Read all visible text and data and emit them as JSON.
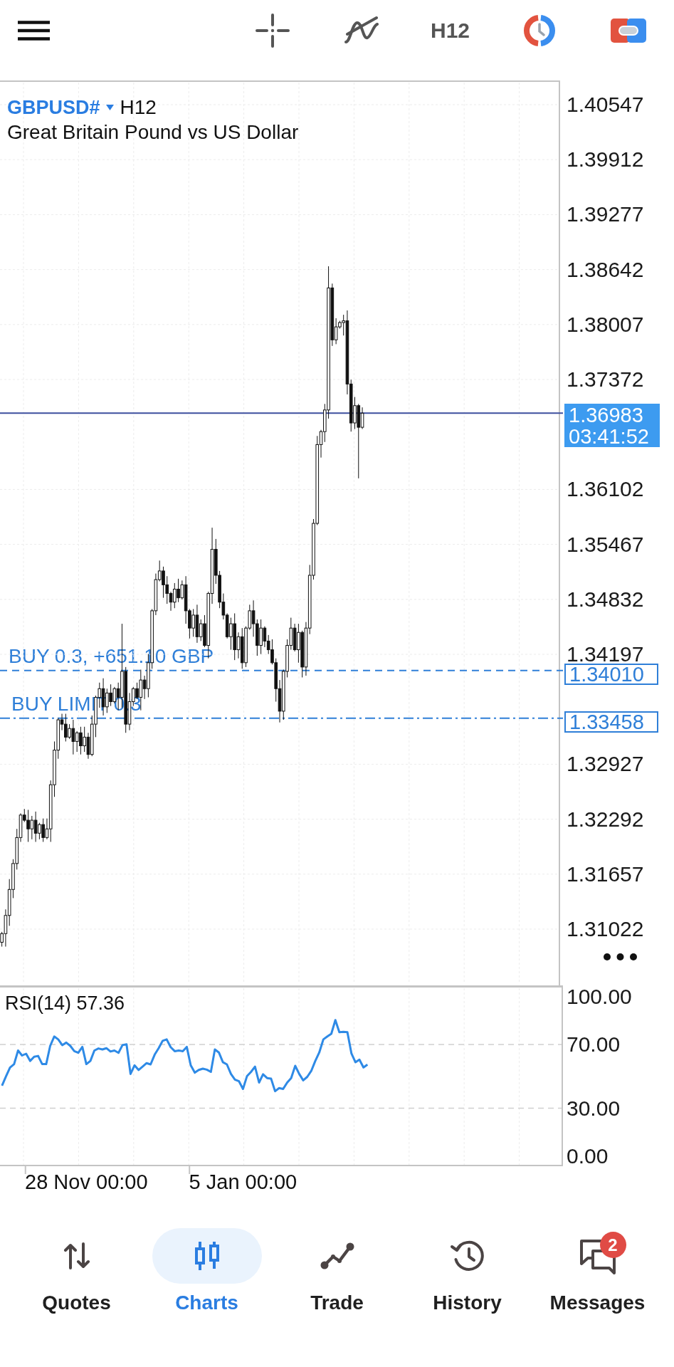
{
  "toolbar": {
    "timeframe": "H12"
  },
  "chart": {
    "symbol": "GBPUSD#",
    "timeframe": "H12",
    "description": "Great Britain Pound vs US Dollar",
    "chart_data": {
      "type": "candlestick",
      "grid": true,
      "ylim": [
        1.30372,
        1.40827
      ],
      "categories": [
        null,
        null,
        null,
        null,
        null,
        null,
        null,
        null,
        null,
        null,
        null,
        null,
        null,
        null,
        null,
        null,
        null,
        null,
        null,
        null,
        null,
        null,
        null,
        null,
        null,
        null,
        null,
        null,
        null,
        null,
        null,
        null,
        null,
        null,
        null,
        null,
        null,
        null,
        null,
        null,
        null,
        null,
        null,
        null,
        null,
        null,
        null,
        null,
        null,
        null,
        null,
        null,
        null,
        null,
        null,
        null,
        null,
        null,
        null,
        null,
        null,
        null,
        null,
        null,
        null,
        null,
        null,
        null,
        null,
        null,
        null,
        null,
        null,
        null,
        null,
        null,
        null,
        null,
        null,
        null,
        null,
        null,
        null,
        null,
        null,
        null,
        null,
        null,
        null,
        null,
        null,
        null,
        null,
        null,
        null,
        null,
        null,
        null,
        null,
        null,
        null,
        null,
        null,
        null,
        null,
        null,
        null,
        null,
        null,
        null,
        null,
        null,
        null,
        null,
        null,
        null,
        null,
        null,
        null,
        null,
        null,
        null,
        null,
        null,
        null,
        null,
        null,
        null,
        null,
        null,
        null,
        null,
        null,
        null,
        null,
        null,
        null,
        null,
        null,
        null,
        null,
        null,
        null,
        null,
        null,
        null,
        null,
        null,
        null
      ],
      "ohlc": [
        [
          1.3087,
          1.3099,
          1.3082,
          1.3097
        ],
        [
          1.3097,
          1.3125,
          1.3082,
          1.3118
        ],
        [
          1.3118,
          1.316,
          1.3106,
          1.3148
        ],
        [
          1.3148,
          1.3183,
          1.3138,
          1.3178
        ],
        [
          1.3178,
          1.3218,
          1.3171,
          1.3208
        ],
        [
          1.3208,
          1.3236,
          1.3203,
          1.3234
        ],
        [
          1.3234,
          1.3241,
          1.3226,
          1.3228
        ],
        [
          1.3228,
          1.324,
          1.3203,
          1.3218
        ],
        [
          1.3218,
          1.3233,
          1.3206,
          1.3228
        ],
        [
          1.3228,
          1.3238,
          1.3203,
          1.3213
        ],
        [
          1.3213,
          1.3225,
          1.3206,
          1.3223
        ],
        [
          1.3223,
          1.323,
          1.3203,
          1.3208
        ],
        [
          1.3208,
          1.323,
          1.3206,
          1.3218
        ],
        [
          1.3218,
          1.3274,
          1.3203,
          1.3269
        ],
        [
          1.3269,
          1.3319,
          1.3255,
          1.3309
        ],
        [
          1.3309,
          1.3346,
          1.3299,
          1.3344
        ],
        [
          1.3344,
          1.3351,
          1.3332,
          1.3339
        ],
        [
          1.3339,
          1.3351,
          1.3319,
          1.3324
        ],
        [
          1.3324,
          1.3339,
          1.3322,
          1.3334
        ],
        [
          1.3334,
          1.3344,
          1.3304,
          1.3319
        ],
        [
          1.3319,
          1.3331,
          1.3307,
          1.3329
        ],
        [
          1.3329,
          1.3336,
          1.3304,
          1.3314
        ],
        [
          1.3314,
          1.3336,
          1.3307,
          1.3324
        ],
        [
          1.3324,
          1.3329,
          1.3299,
          1.3304
        ],
        [
          1.3304,
          1.3349,
          1.3302,
          1.3339
        ],
        [
          1.3339,
          1.3372,
          1.3324,
          1.337
        ],
        [
          1.337,
          1.3387,
          1.3358,
          1.338
        ],
        [
          1.338,
          1.3392,
          1.3349,
          1.3359
        ],
        [
          1.3359,
          1.338,
          1.3352,
          1.3375
        ],
        [
          1.3375,
          1.3385,
          1.336,
          1.3365
        ],
        [
          1.3365,
          1.3382,
          1.3363,
          1.338
        ],
        [
          1.338,
          1.3387,
          1.3355,
          1.337
        ],
        [
          1.337,
          1.3455,
          1.3358,
          1.34
        ],
        [
          1.34,
          1.3405,
          1.3329,
          1.3339
        ],
        [
          1.3339,
          1.3375,
          1.3332,
          1.3365
        ],
        [
          1.3365,
          1.3382,
          1.336,
          1.338
        ],
        [
          1.338,
          1.3387,
          1.3368,
          1.337
        ],
        [
          1.337,
          1.3402,
          1.3355,
          1.339
        ],
        [
          1.339,
          1.3395,
          1.3368,
          1.338
        ],
        [
          1.338,
          1.342,
          1.337,
          1.341
        ],
        [
          1.341,
          1.3472,
          1.3403,
          1.347
        ],
        [
          1.347,
          1.3513,
          1.3465,
          1.3506
        ],
        [
          1.3506,
          1.3528,
          1.3504,
          1.3516
        ],
        [
          1.3516,
          1.3521,
          1.3485,
          1.35
        ],
        [
          1.35,
          1.351,
          1.3478,
          1.349
        ],
        [
          1.349,
          1.3492,
          1.347,
          1.348
        ],
        [
          1.348,
          1.3502,
          1.3473,
          1.3495
        ],
        [
          1.3495,
          1.3507,
          1.348,
          1.3485
        ],
        [
          1.3485,
          1.3505,
          1.3483,
          1.35
        ],
        [
          1.35,
          1.351,
          1.3455,
          1.347
        ],
        [
          1.347,
          1.3472,
          1.3438,
          1.345
        ],
        [
          1.345,
          1.3472,
          1.344,
          1.3465
        ],
        [
          1.3465,
          1.3477,
          1.3433,
          1.344
        ],
        [
          1.344,
          1.346,
          1.3435,
          1.3455
        ],
        [
          1.3455,
          1.3465,
          1.3428,
          1.343
        ],
        [
          1.343,
          1.3492,
          1.3415,
          1.349
        ],
        [
          1.349,
          1.3566,
          1.3478,
          1.3541
        ],
        [
          1.3541,
          1.3553,
          1.3501,
          1.3511
        ],
        [
          1.3511,
          1.3516,
          1.3473,
          1.348
        ],
        [
          1.348,
          1.349,
          1.346,
          1.3465
        ],
        [
          1.3465,
          1.3467,
          1.3438,
          1.344
        ],
        [
          1.344,
          1.3462,
          1.3425,
          1.3455
        ],
        [
          1.3455,
          1.3467,
          1.3413,
          1.3425
        ],
        [
          1.3425,
          1.3445,
          1.3415,
          1.344
        ],
        [
          1.344,
          1.345,
          1.3403,
          1.341
        ],
        [
          1.341,
          1.3452,
          1.3405,
          1.345
        ],
        [
          1.345,
          1.3477,
          1.3448,
          1.347
        ],
        [
          1.347,
          1.3482,
          1.344,
          1.3455
        ],
        [
          1.3455,
          1.346,
          1.3418,
          1.343
        ],
        [
          1.343,
          1.346,
          1.342,
          1.345
        ],
        [
          1.345,
          1.3452,
          1.3428,
          1.3435
        ],
        [
          1.3435,
          1.3442,
          1.342,
          1.3425
        ],
        [
          1.3425,
          1.3437,
          1.3408,
          1.341
        ],
        [
          1.341,
          1.3415,
          1.3365,
          1.338
        ],
        [
          1.338,
          1.339,
          1.3341,
          1.3354
        ],
        [
          1.3354,
          1.3402,
          1.3344,
          1.34
        ],
        [
          1.34,
          1.3437,
          1.3393,
          1.343
        ],
        [
          1.343,
          1.3462,
          1.3425,
          1.345
        ],
        [
          1.345,
          1.3455,
          1.3423,
          1.3425
        ],
        [
          1.3425,
          1.3455,
          1.341,
          1.3445
        ],
        [
          1.3445,
          1.3447,
          1.3393,
          1.3405
        ],
        [
          1.3405,
          1.3457,
          1.3395,
          1.345
        ],
        [
          1.345,
          1.3523,
          1.3443,
          1.3511
        ],
        [
          1.3511,
          1.3576,
          1.3506,
          1.3571
        ],
        [
          1.3571,
          1.3672,
          1.3569,
          1.3662
        ],
        [
          1.3662,
          1.3679,
          1.3647,
          1.3677
        ],
        [
          1.3677,
          1.3709,
          1.3665,
          1.3702
        ],
        [
          1.3702,
          1.3868,
          1.3692,
          1.3843
        ],
        [
          1.3843,
          1.3848,
          1.3776,
          1.3783
        ],
        [
          1.3783,
          1.3808,
          1.3778,
          1.3798
        ],
        [
          1.3798,
          1.3805,
          1.3796,
          1.3803
        ],
        [
          1.3803,
          1.3812,
          1.3788,
          1.3805
        ],
        [
          1.3805,
          1.3817,
          1.372,
          1.3732
        ],
        [
          1.3732,
          1.3737,
          1.3677,
          1.3687
        ],
        [
          1.3687,
          1.3717,
          1.368,
          1.3707
        ],
        [
          1.3707,
          1.3709,
          1.3623,
          1.3682
        ],
        [
          1.3682,
          1.3705,
          1.368,
          1.36983
        ],
        null,
        null,
        null,
        null,
        null,
        null,
        null,
        null,
        null,
        null,
        null,
        null,
        null,
        null,
        null,
        null,
        null,
        null,
        null,
        null,
        null,
        null,
        null,
        null,
        null,
        null,
        null,
        null,
        null,
        null,
        null,
        null,
        null,
        null,
        null,
        null,
        null,
        null,
        null,
        null,
        null,
        null,
        null,
        null,
        null,
        null,
        null,
        null,
        null,
        null,
        null,
        null
      ],
      "ref_lines": [
        {
          "axis": "y",
          "value": 1.36983,
          "label": "1.36983",
          "color": "#3c4f9e"
        },
        {
          "axis": "y",
          "value": 1.3401,
          "label": "1.34010",
          "color": "#2f7fd8"
        },
        {
          "axis": "y",
          "value": 1.33458,
          "label": "1.33458",
          "color": "#2f7fd8"
        }
      ],
      "yticks": [
        {
          "value": 1.40547,
          "label": "1.40547"
        },
        {
          "value": 1.39912,
          "label": "1.39912"
        },
        {
          "value": 1.39277,
          "label": "1.39277"
        },
        {
          "value": 1.38642,
          "label": "1.38642"
        },
        {
          "value": 1.38007,
          "label": "1.38007"
        },
        {
          "value": 1.37372,
          "label": "1.37372"
        },
        {
          "value": 1.36102,
          "label": "1.36102"
        },
        {
          "value": 1.35467,
          "label": "1.35467"
        },
        {
          "value": 1.34832,
          "label": "1.34832"
        },
        {
          "value": 1.34197,
          "label": "1.34197"
        },
        {
          "value": 1.32927,
          "label": "1.32927"
        },
        {
          "value": 1.32292,
          "label": "1.32292"
        },
        {
          "value": 1.31657,
          "label": "1.31657"
        },
        {
          "value": 1.31022,
          "label": "1.31022"
        }
      ]
    },
    "current_price": {
      "countdown": "03:41:52"
    },
    "orders": [
      {
        "kind": "position",
        "label": "BUY 0.3, +651.10 GBP"
      },
      {
        "kind": "limit",
        "label": "BUY LIMIT 0.3"
      }
    ]
  },
  "rsi": {
    "chart_data": {
      "type": "line",
      "title": "RSI(14) 57.36",
      "grid": true,
      "ylim": [
        -6.4,
        107.1
      ],
      "categories": [
        null,
        null,
        null,
        null,
        null,
        null,
        null,
        null,
        null,
        null,
        null,
        null,
        null,
        null,
        null,
        null,
        null,
        null,
        null,
        null,
        null,
        "28 Nov 00:00",
        null,
        null,
        null,
        null,
        null,
        null,
        null,
        null,
        null,
        null,
        null,
        null,
        null,
        null,
        null,
        null,
        null,
        null,
        null,
        null,
        null,
        null,
        null,
        null,
        null,
        null,
        null,
        null,
        null,
        null,
        null,
        null,
        null,
        null,
        null,
        null,
        null,
        null,
        "5 Jan 00:00",
        null,
        null,
        null,
        null,
        null,
        null,
        null,
        null,
        null,
        null,
        null,
        null,
        null,
        null,
        null,
        null,
        null,
        null,
        null,
        null,
        null,
        null,
        null,
        null,
        null,
        null,
        null,
        null,
        null,
        null,
        null,
        null,
        null,
        null,
        null,
        null,
        null,
        null,
        null,
        null,
        null,
        null,
        null,
        null,
        null,
        null,
        null,
        null,
        null,
        null,
        null,
        null,
        null,
        null,
        null,
        null,
        null,
        null,
        null,
        null,
        null,
        null,
        null,
        null,
        null,
        null,
        null,
        null,
        null,
        null,
        null,
        null,
        null,
        null,
        null,
        null,
        null,
        null,
        null
      ],
      "yticks": [
        {
          "value": 100,
          "label": "100.00"
        },
        {
          "value": 70,
          "label": "70.00"
        },
        {
          "value": 30,
          "label": "30.00"
        },
        {
          "value": 0,
          "label": "0.00"
        }
      ],
      "series": [
        {
          "color": "#2e8ae6",
          "values": [
            44.2,
            50.1,
            55.6,
            57.7,
            66.2,
            63.1,
            64.2,
            59.7,
            62.3,
            62.8,
            57.7,
            57.7,
            69.1,
            75.0,
            73.2,
            69.6,
            71.2,
            69.1,
            65.8,
            64.8,
            68.5,
            57.7,
            59.7,
            66.2,
            67.5,
            66.9,
            67.7,
            65.6,
            66.2,
            64.8,
            69.6,
            70.1,
            51.5,
            56.9,
            54.0,
            56.1,
            58.3,
            57.5,
            63.6,
            67.7,
            72.3,
            73.2,
            68.3,
            65.8,
            66.2,
            65.8,
            68.5,
            56.9,
            52.3,
            54.0,
            54.8,
            54.2,
            52.8,
            66.9,
            65.0,
            58.9,
            57.5,
            51.5,
            48.0,
            46.9,
            42.1,
            50.1,
            52.8,
            56.1,
            46.1,
            51.3,
            48.9,
            48.5,
            40.7,
            42.6,
            42.1,
            46.1,
            48.9,
            56.6,
            51.5,
            47.5,
            49.7,
            53.4,
            59.7,
            65.0,
            73.2,
            75.0,
            76.7,
            85.3,
            77.7,
            77.9,
            77.7,
            64.4,
            58.9,
            60.5,
            55.6,
            57.4,
            null,
            null,
            null,
            null,
            null,
            null,
            null,
            null,
            null,
            null,
            null,
            null,
            null,
            null,
            null,
            null,
            null,
            null,
            null,
            null,
            null,
            null,
            null,
            null,
            null,
            null,
            null,
            null,
            null,
            null,
            null,
            null,
            null,
            null,
            null,
            null,
            null,
            null,
            null,
            null,
            null,
            null,
            null,
            null,
            null,
            null,
            null,
            null
          ]
        }
      ]
    }
  },
  "bottom_nav": [
    {
      "label": "Quotes",
      "selected": false
    },
    {
      "label": "Charts",
      "selected": true
    },
    {
      "label": "Trade",
      "selected": false
    },
    {
      "label": "History",
      "selected": false
    },
    {
      "label": "Messages",
      "selected": false,
      "badge": "2"
    }
  ]
}
